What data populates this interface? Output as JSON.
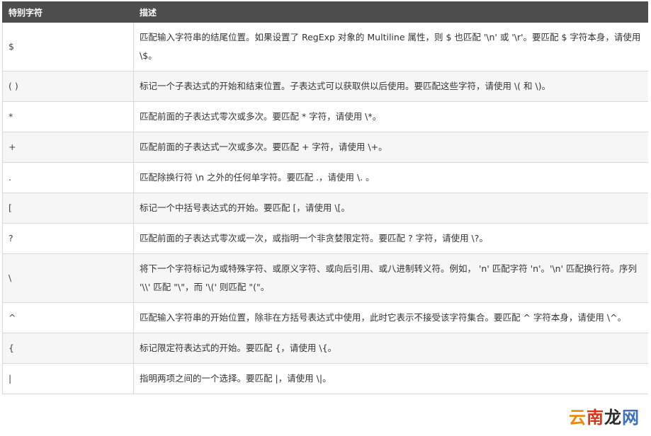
{
  "table": {
    "headers": [
      "特别字符",
      "描述"
    ],
    "rows": [
      {
        "char": "$",
        "desc": "匹配输入字符串的结尾位置。如果设置了 RegExp 对象的 Multiline 属性，则 $ 也匹配 '\\n' 或 '\\r'。要匹配 $ 字符本身，请使用 \\$。"
      },
      {
        "char": "( )",
        "desc": "标记一个子表达式的开始和结束位置。子表达式可以获取供以后使用。要匹配这些字符，请使用 \\( 和 \\)。"
      },
      {
        "char": "*",
        "desc": "匹配前面的子表达式零次或多次。要匹配 * 字符，请使用 \\*。"
      },
      {
        "char": "+",
        "desc": "匹配前面的子表达式一次或多次。要匹配 + 字符，请使用 \\+。"
      },
      {
        "char": ".",
        "desc": "匹配除换行符 \\n 之外的任何单字符。要匹配 .，请使用 \\. 。"
      },
      {
        "char": "[",
        "desc": "标记一个中括号表达式的开始。要匹配 [，请使用 \\[。"
      },
      {
        "char": "?",
        "desc": "匹配前面的子表达式零次或一次，或指明一个非贪婪限定符。要匹配 ? 字符，请使用 \\?。"
      },
      {
        "char": "\\",
        "desc": "将下一个字符标记为或特殊字符、或原义字符、或向后引用、或八进制转义符。例如， 'n' 匹配字符 'n'。'\\n' 匹配换行符。序列 '\\\\' 匹配 \"\\\"，而 '\\(' 则匹配 \"(\"。"
      },
      {
        "char": "^",
        "desc": "匹配输入字符串的开始位置，除非在方括号表达式中使用，此时它表示不接受该字符集合。要匹配 ^ 字符本身，请使用 \\^。"
      },
      {
        "char": "{",
        "desc": "标记限定符表达式的开始。要匹配 {，请使用 \\{。"
      },
      {
        "char": "|",
        "desc": "指明两项之间的一个选择。要匹配 |，请使用 \\|。"
      }
    ]
  },
  "watermark": {
    "chars": [
      "云",
      "南",
      "龙",
      "网"
    ],
    "colors": [
      "#e8890c",
      "#d03a1c",
      "#2c2c2c",
      "#3e6fb8"
    ]
  }
}
